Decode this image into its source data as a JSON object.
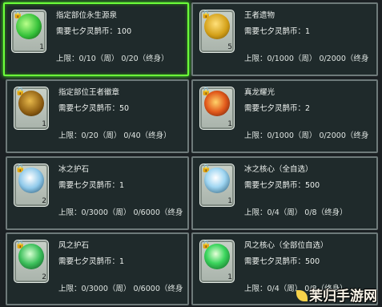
{
  "items": [
    {
      "name": "指定部位永生源泉",
      "price": "需要七夕灵鹊币：100",
      "limit": "上限：0/10（周） 0/20（终身）",
      "count": "1",
      "icon": "green-leaf-icon",
      "icon_color": "#36c23a",
      "selected": true
    },
    {
      "name": "王者遗物",
      "price": "需要七夕灵鹊币：1",
      "limit": "上限：0/1000（周） 0/2000（终身",
      "count": "5",
      "icon": "gold-coin-icon",
      "icon_color": "#d3a019",
      "selected": false
    },
    {
      "name": "指定部位王者徽章",
      "price": "需要七夕灵鹊币：50",
      "limit": "上限：0/20（周） 0/40（终身）",
      "count": "1",
      "icon": "gold-emblem-icon",
      "icon_color": "#b8861a",
      "selected": false
    },
    {
      "name": "真龙耀光",
      "price": "需要七夕灵鹊币：2",
      "limit": "上限：0/1000（周） 0/2000（终身",
      "count": "1",
      "icon": "fire-orb-icon",
      "icon_color": "#e25a1c",
      "selected": false
    },
    {
      "name": "冰之护石",
      "price": "需要七夕灵鹊币：1",
      "limit": "上限：0/3000（周） 0/6000（终身",
      "count": "2",
      "icon": "ice-crystal-icon",
      "icon_color": "#cfe8f7",
      "selected": false
    },
    {
      "name": "冰之核心（全自选）",
      "price": "需要七夕灵鹊币：500",
      "limit": "上限：0/4（周） 0/8（终身）",
      "count": "1",
      "icon": "ice-core-icon",
      "icon_color": "#a8d8f2",
      "selected": false
    },
    {
      "name": "风之护石",
      "price": "需要七夕灵鹊币：1",
      "limit": "上限：0/3000（周） 0/6000（终身",
      "count": "2",
      "icon": "wind-stone-icon",
      "icon_color": "#3bbf5a",
      "selected": false
    },
    {
      "name": "风之核心（全部位自选）",
      "price": "需要七夕灵鹊币：500",
      "limit": "上限：0/4（周） 0/8（终身）",
      "count": "1",
      "icon": "wind-core-icon",
      "icon_color": "#3cd65e",
      "selected": false
    }
  ],
  "watermark": "茉归手游网"
}
